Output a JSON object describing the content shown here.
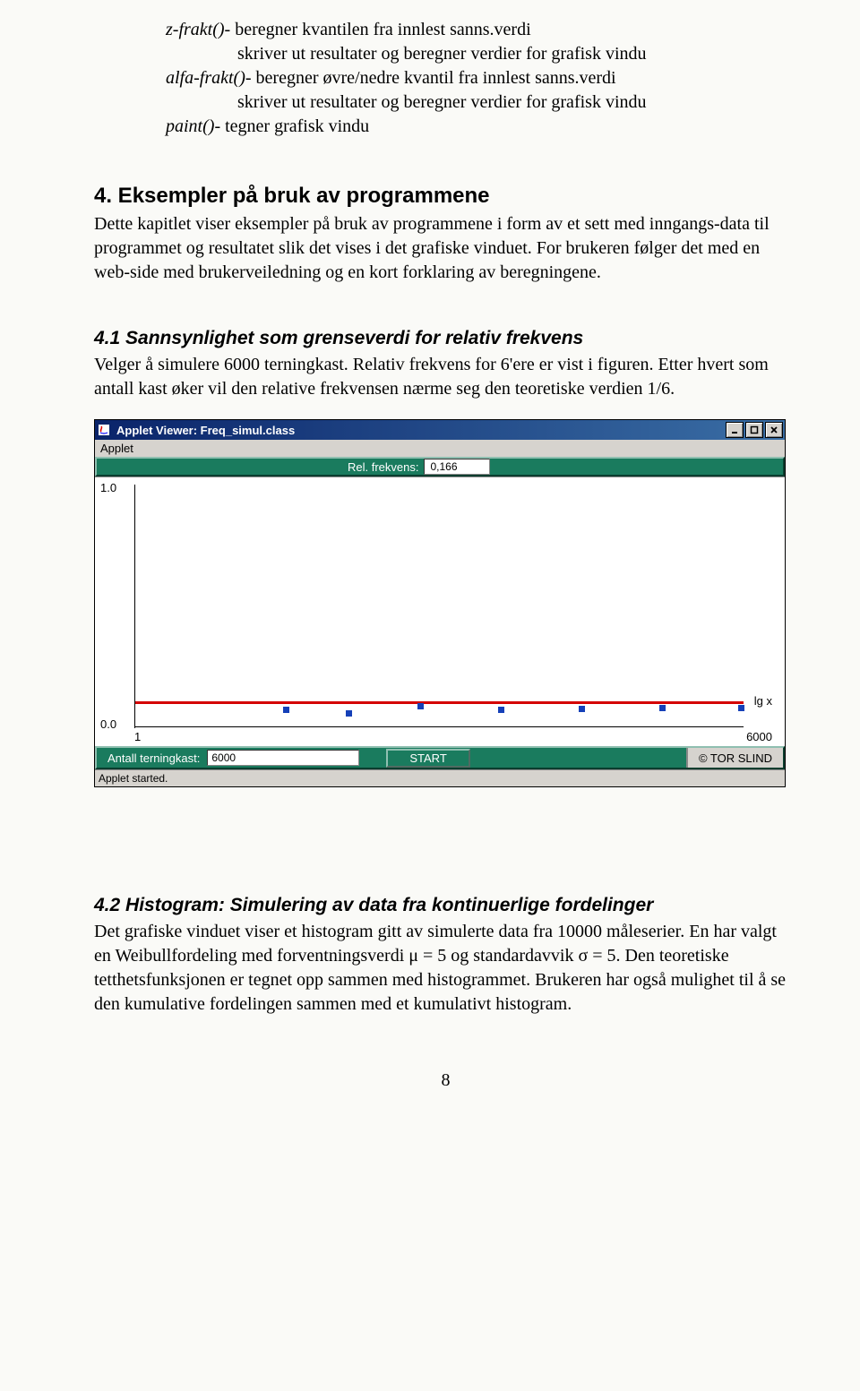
{
  "funcs": {
    "zfrakt_name": "z-frakt()",
    "zfrakt_desc": "- beregner kvantilen fra innlest sanns.verdi",
    "zfrakt_sub": "skriver ut resultater og beregner verdier for grafisk vindu",
    "alfafrakt_name": "alfa-frakt()",
    "alfafrakt_desc": "- beregner øvre/nedre kvantil fra innlest sanns.verdi",
    "alfafrakt_sub": "skriver ut resultater og beregner verdier for grafisk vindu",
    "paint_name": "paint()",
    "paint_desc": "- tegner grafisk vindu"
  },
  "sec4": {
    "title": "4. Eksempler på bruk av programmene",
    "body": "Dette kapitlet viser eksempler på bruk av programmene i form av et sett med inngangs-data til programmet og resultatet slik det vises i det grafiske vinduet. For brukeren følger det med en web-side med brukerveiledning og en kort forklaring av beregningene."
  },
  "sec41": {
    "title": "4.1 Sannsynlighet som grenseverdi for relativ frekvens",
    "body": "Velger å simulere 6000 terningkast. Relativ frekvens for 6'ere er vist i figuren. Etter hvert som antall kast øker vil den relative frekvensen nærme seg den teoretiske verdien 1/6."
  },
  "applet": {
    "title": "Applet Viewer: Freq_simul.class",
    "menu": "Applet",
    "rel_label": "Rel. frekvens:",
    "rel_value": "0,166",
    "y_top": "1.0",
    "y_bot": "0.0",
    "x_left": "1",
    "x_right": "6000",
    "x_axis_label": "lg x",
    "control_label": "Antall terningkast:",
    "control_value": "6000",
    "start": "START",
    "copyright": "© TOR SLIND",
    "status": "Applet started."
  },
  "sec42": {
    "title": "4.2 Histogram: Simulering av data fra kontinuerlige fordelinger",
    "body": "Det grafiske vinduet viser et histogram gitt av simulerte data fra 10000 måleserier. En har valgt en Weibullfordeling med forventningsverdi μ = 5 og standardavvik σ = 5. Den teoretiske tetthetsfunksjonen er tegnet opp sammen med histogrammet. Brukeren har også mulighet til å se den kumulative fordelingen sammen med et kumulativt histogram."
  },
  "page_number": "8",
  "chart_data": {
    "type": "scatter+line",
    "x_scale": "log",
    "x_range": [
      1,
      6000
    ],
    "y_range": [
      0.0,
      1.0
    ],
    "reference_line_y": 0.1667,
    "series": [
      {
        "name": "Rel. frekvens",
        "color": "#1540b8",
        "points_approx": [
          {
            "x": 30,
            "y": 0.17
          },
          {
            "x": 80,
            "y": 0.16
          },
          {
            "x": 200,
            "y": 0.18
          },
          {
            "x": 500,
            "y": 0.17
          },
          {
            "x": 1200,
            "y": 0.165
          },
          {
            "x": 2500,
            "y": 0.167
          },
          {
            "x": 6000,
            "y": 0.166
          }
        ]
      }
    ]
  }
}
